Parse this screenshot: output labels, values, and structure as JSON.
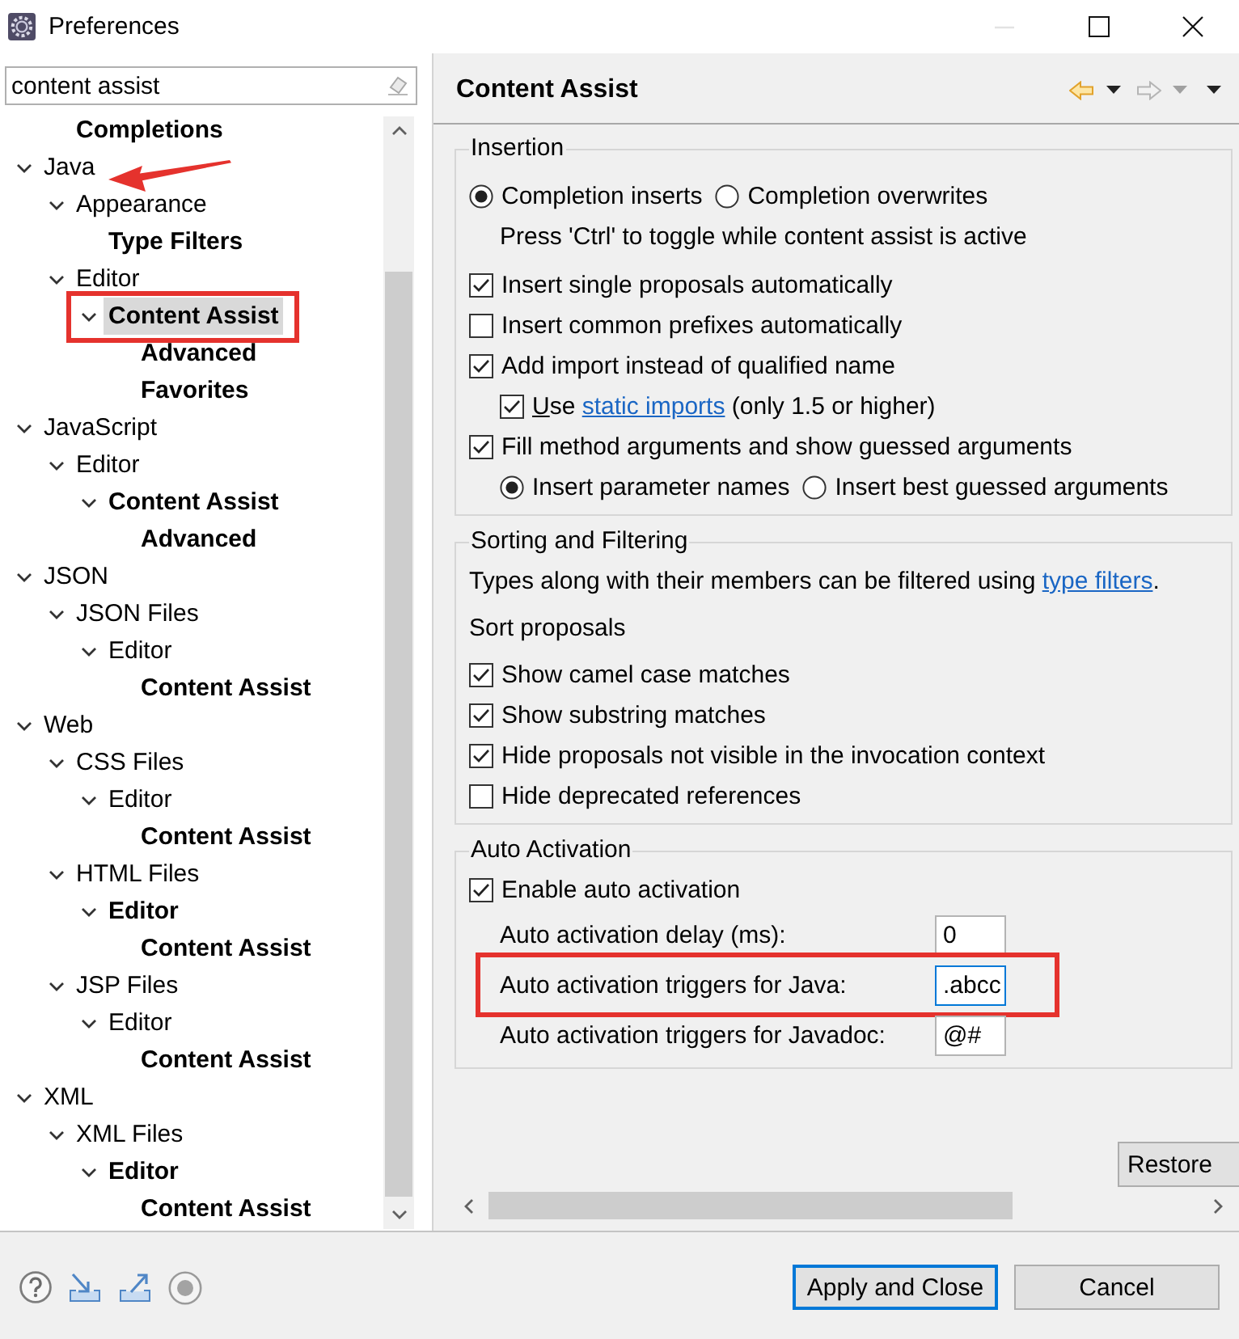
{
  "window": {
    "title": "Preferences"
  },
  "sidebar": {
    "search": {
      "value": "content assist"
    },
    "tree": [
      {
        "children": [
          {
            "label": "Completions",
            "match": true,
            "selected": false
          }
        ]
      },
      {
        "label": "Java",
        "match": false,
        "selected": false,
        "expanded": true,
        "arrow": true,
        "children": [
          {
            "label": "Appearance",
            "match": false,
            "selected": false,
            "expanded": true,
            "children": [
              {
                "label": "Type Filters",
                "match": true,
                "selected": false
              }
            ]
          },
          {
            "label": "Editor",
            "match": false,
            "selected": false,
            "expanded": true,
            "children": [
              {
                "label": "Content Assist",
                "match": true,
                "selected": true,
                "expanded": true,
                "framed": true,
                "children": [
                  {
                    "label": "Advanced",
                    "match": true,
                    "selected": false
                  },
                  {
                    "label": "Favorites",
                    "match": true,
                    "selected": false
                  }
                ]
              }
            ]
          }
        ]
      },
      {
        "label": "JavaScript",
        "match": false,
        "selected": false,
        "expanded": true,
        "children": [
          {
            "label": "Editor",
            "match": false,
            "selected": false,
            "expanded": true,
            "children": [
              {
                "label": "Content Assist",
                "match": true,
                "selected": false,
                "expanded": true,
                "children": [
                  {
                    "label": "Advanced",
                    "match": true,
                    "selected": false
                  }
                ]
              }
            ]
          }
        ]
      },
      {
        "label": "JSON",
        "match": false,
        "selected": false,
        "expanded": true,
        "children": [
          {
            "label": "JSON Files",
            "match": false,
            "selected": false,
            "expanded": true,
            "children": [
              {
                "label": "Editor",
                "match": false,
                "selected": false,
                "expanded": true,
                "children": [
                  {
                    "label": "Content Assist",
                    "match": true,
                    "selected": false
                  }
                ]
              }
            ]
          }
        ]
      },
      {
        "label": "Web",
        "match": false,
        "selected": false,
        "expanded": true,
        "children": [
          {
            "label": "CSS Files",
            "match": false,
            "selected": false,
            "expanded": true,
            "children": [
              {
                "label": "Editor",
                "match": false,
                "selected": false,
                "expanded": true,
                "children": [
                  {
                    "label": "Content Assist",
                    "match": true,
                    "selected": false
                  }
                ]
              }
            ]
          },
          {
            "label": "HTML Files",
            "match": false,
            "selected": false,
            "expanded": true,
            "children": [
              {
                "label": "Editor",
                "match": true,
                "selected": false,
                "expanded": true,
                "children": [
                  {
                    "label": "Content Assist",
                    "match": true,
                    "selected": false
                  }
                ]
              }
            ]
          },
          {
            "label": "JSP Files",
            "match": false,
            "selected": false,
            "expanded": true,
            "children": [
              {
                "label": "Editor",
                "match": false,
                "selected": false,
                "expanded": true,
                "children": [
                  {
                    "label": "Content Assist",
                    "match": true,
                    "selected": false
                  }
                ]
              }
            ]
          }
        ]
      },
      {
        "label": "XML",
        "match": false,
        "selected": false,
        "expanded": true,
        "children": [
          {
            "label": "XML Files",
            "match": false,
            "selected": false,
            "expanded": true,
            "children": [
              {
                "label": "Editor",
                "match": true,
                "selected": false,
                "expanded": true,
                "children": [
                  {
                    "label": "Content Assist",
                    "match": true,
                    "selected": false
                  }
                ]
              }
            ]
          }
        ]
      }
    ]
  },
  "page": {
    "title": "Content Assist",
    "history": {
      "back": {
        "disabled": false
      },
      "forward": {
        "disabled": true
      }
    },
    "groups": [
      {
        "title": "Insertion",
        "items": [
          {
            "kind": "radios",
            "options": [
              {
                "label": "Completion inserts",
                "selected": true
              },
              {
                "label": "Completion overwrites",
                "selected": false
              }
            ]
          },
          {
            "kind": "note",
            "text": "Press 'Ctrl' to toggle while content assist is active"
          },
          {
            "kind": "checkbox",
            "label": "Insert single proposals automatically",
            "checked": true
          },
          {
            "kind": "checkbox",
            "label": "Insert common prefixes automatically",
            "checked": false
          },
          {
            "kind": "checkbox",
            "label": "Add import instead of qualified name",
            "checked": true,
            "children": [
              {
                "kind": "checkbox",
                "label": "Use",
                "mnemonic": true,
                "link": "static imports",
                "after": "(only 1.5 or higher)",
                "checked": true
              }
            ]
          },
          {
            "kind": "checkbox",
            "label": "Fill method arguments and show guessed arguments",
            "checked": true,
            "children": [
              {
                "kind": "radios",
                "options": [
                  {
                    "label": "Insert parameter names",
                    "selected": true
                  },
                  {
                    "label": "Insert best guessed arguments",
                    "selected": false
                  }
                ]
              }
            ]
          }
        ]
      },
      {
        "title": "Sorting and Filtering",
        "items": [
          {
            "kind": "text",
            "text": "Types along with their members can be filtered using",
            "link": "type filters",
            "after": "."
          },
          {
            "kind": "heading",
            "text": "Sort proposals"
          },
          {
            "kind": "checkbox",
            "label": "Show camel case matches",
            "checked": true
          },
          {
            "kind": "checkbox",
            "label": "Show substring matches",
            "checked": true
          },
          {
            "kind": "checkbox",
            "label": "Hide proposals not visible in the invocation context",
            "checked": true
          },
          {
            "kind": "checkbox",
            "label": "Hide deprecated references",
            "checked": false
          }
        ]
      },
      {
        "title": "Auto Activation",
        "items": [
          {
            "kind": "checkbox",
            "label": "Enable auto activation",
            "checked": true,
            "children": [
              {
                "kind": "field",
                "label": "Auto activation delay (ms):",
                "value": "0",
                "focused": false
              },
              {
                "kind": "field",
                "label": "Auto activation triggers for Java:",
                "value": ".abcc",
                "focused": true,
                "framed": true
              },
              {
                "kind": "field",
                "label": "Auto activation triggers for Javadoc:",
                "value": "@#",
                "focused": false
              }
            ]
          }
        ]
      }
    ],
    "restore_button": {
      "label": "Restore"
    }
  },
  "footer": {
    "buttons": [
      {
        "label": "Apply and Close",
        "default": true
      },
      {
        "label": "Cancel",
        "default": false
      }
    ]
  }
}
